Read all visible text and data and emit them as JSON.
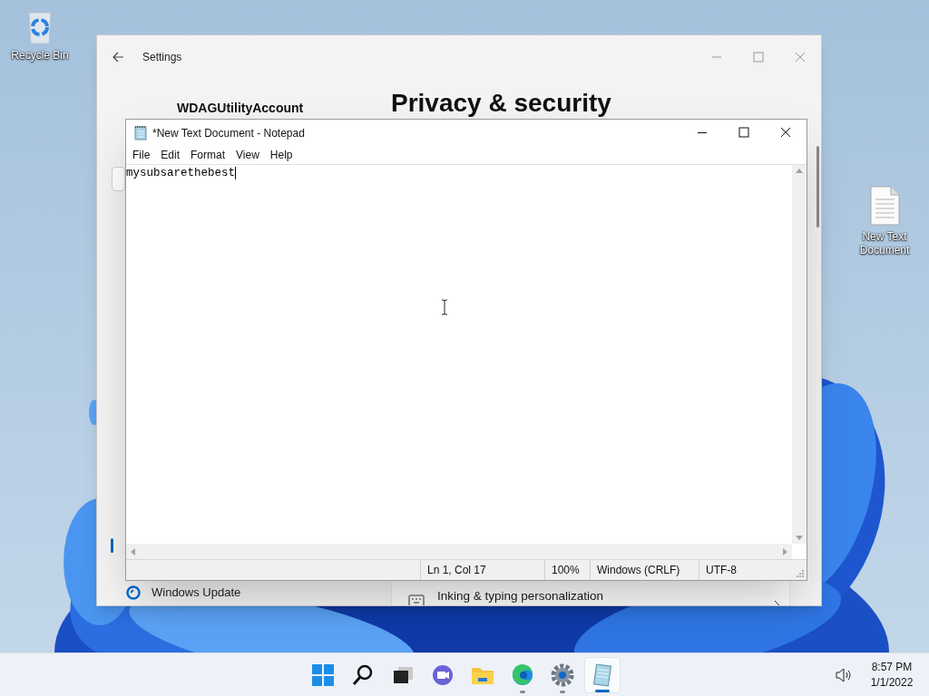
{
  "desktop_icons": [
    {
      "kind": "recycle-bin",
      "label": "Recycle Bin"
    },
    {
      "kind": "text-file",
      "label": "New Text Document"
    }
  ],
  "settings": {
    "title": "Settings",
    "account_name": "WDAGUtilityAccount",
    "page_title": "Privacy & security",
    "sidebar_items": [
      {
        "label": "Windows Update",
        "selected": false
      }
    ],
    "rows": [
      {
        "label": "Inking & typing personalization"
      }
    ]
  },
  "notepad": {
    "title": "*New Text Document - Notepad",
    "menu": [
      "File",
      "Edit",
      "Format",
      "View",
      "Help"
    ],
    "text": "mysubsarethebest",
    "status": [
      "Ln 1, Col 17",
      "100%",
      "Windows (CRLF)",
      "UTF-8"
    ]
  },
  "taskbar": {
    "apps": [
      {
        "kind": "start",
        "running": false,
        "selected": false
      },
      {
        "kind": "search",
        "running": false,
        "selected": false
      },
      {
        "kind": "task-view",
        "running": false,
        "selected": false
      },
      {
        "kind": "chat",
        "running": false,
        "selected": false
      },
      {
        "kind": "explorer",
        "running": false,
        "selected": false
      },
      {
        "kind": "edge",
        "running": true,
        "selected": false
      },
      {
        "kind": "settings",
        "running": true,
        "selected": false
      },
      {
        "kind": "notepad",
        "running": true,
        "selected": true
      }
    ],
    "time": "8:57 PM",
    "date": "1/1/2022"
  }
}
